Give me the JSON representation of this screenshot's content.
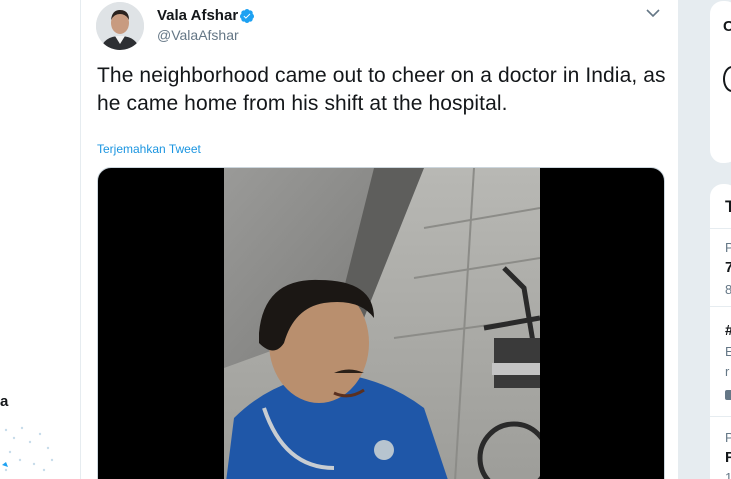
{
  "tweet": {
    "author_name": "Vala Afshar",
    "author_handle": "@ValaAfshar",
    "text": "The neighborhood came out to cheer on a doctor in India, as he came home from his shift at the hospital.",
    "translate_label": "Terjemahkan Tweet",
    "verified": true
  },
  "left_fragment": "a",
  "right_fragments": {
    "card1_header": "C",
    "card2_header": "T",
    "trend1_meta": "P",
    "trend1_name": "7",
    "trend1_count": "8",
    "trend2_name": "#",
    "trend2_line1": "E",
    "trend2_line2": "r",
    "trend3_meta": "P",
    "trend3_name": "F",
    "trend3_count": "1"
  },
  "colors": {
    "accent": "#1b95e0",
    "verified": "#1da1f2",
    "text_primary": "#14171a",
    "text_secondary": "#657786",
    "background": "#e6ecf0"
  },
  "icons": {
    "verified": "verified-badge-icon",
    "caret": "chevron-down-icon"
  }
}
